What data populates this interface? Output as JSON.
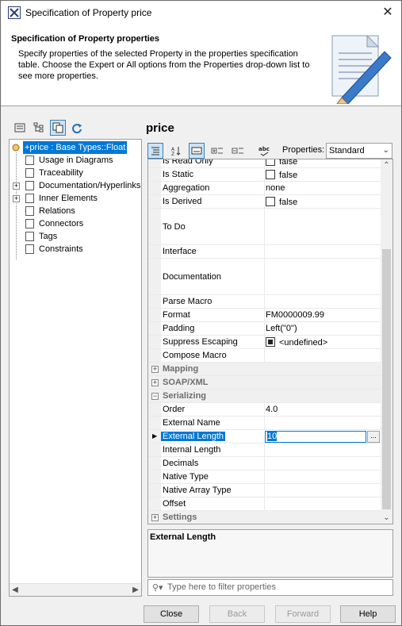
{
  "window": {
    "title": "Specification of Property price",
    "close_symbol": "✕"
  },
  "header": {
    "heading": "Specification of Property properties",
    "description": "Specify properties of the selected Property in the properties specification table. Choose the Expert or All options from the Properties drop-down list to see more properties."
  },
  "tree": {
    "items": [
      {
        "label": "+price : Base Types::Float",
        "selected": true
      },
      {
        "label": "Usage in Diagrams"
      },
      {
        "label": "Traceability"
      },
      {
        "label": "Documentation/Hyperlinks",
        "expandable": true
      },
      {
        "label": "Inner Elements",
        "expandable": true
      },
      {
        "label": "Relations"
      },
      {
        "label": "Connectors"
      },
      {
        "label": "Tags"
      },
      {
        "label": "Constraints"
      }
    ]
  },
  "panel": {
    "title": "price",
    "properties_label": "Properties:",
    "properties_value": "Standard"
  },
  "grid": {
    "rows": [
      {
        "name": "Is Read Only",
        "value": "false",
        "checkbox": true
      },
      {
        "name": "Is Static",
        "value": "false",
        "checkbox": true
      },
      {
        "name": "Aggregation",
        "value": "none"
      },
      {
        "name": "Is Derived",
        "value": "false",
        "checkbox": true
      },
      {
        "name": "To Do",
        "value": ""
      },
      {
        "name": "Interface",
        "value": ""
      },
      {
        "name": "Documentation",
        "value": ""
      },
      {
        "name": "Parse Macro",
        "value": ""
      },
      {
        "name": "Format",
        "value": "FM0000009.99"
      },
      {
        "name": "Padding",
        "value": "Left(\"0\")"
      },
      {
        "name": "Suppress Escaping",
        "value": "<undefined>",
        "filled": true
      },
      {
        "name": "Compose Macro",
        "value": ""
      },
      {
        "name": "Mapping",
        "group": true,
        "expanded": false
      },
      {
        "name": "SOAP/XML",
        "group": true,
        "expanded": false
      },
      {
        "name": "Serializing",
        "group": true,
        "expanded": true
      },
      {
        "name": "Order",
        "value": "4.0"
      },
      {
        "name": "External Name",
        "value": ""
      },
      {
        "name": "External Length",
        "value": "10",
        "selected": true
      },
      {
        "name": "Internal Length",
        "value": ""
      },
      {
        "name": "Decimals",
        "value": ""
      },
      {
        "name": "Native Type",
        "value": ""
      },
      {
        "name": "Native Array Type",
        "value": ""
      },
      {
        "name": "Offset",
        "value": ""
      },
      {
        "name": "Settings",
        "group": true,
        "expanded": false
      }
    ]
  },
  "description_box": {
    "title": "External Length"
  },
  "filter": {
    "placeholder": "Type here to filter properties"
  },
  "buttons": {
    "close": "Close",
    "back": "Back",
    "forward": "Forward",
    "help": "Help"
  }
}
